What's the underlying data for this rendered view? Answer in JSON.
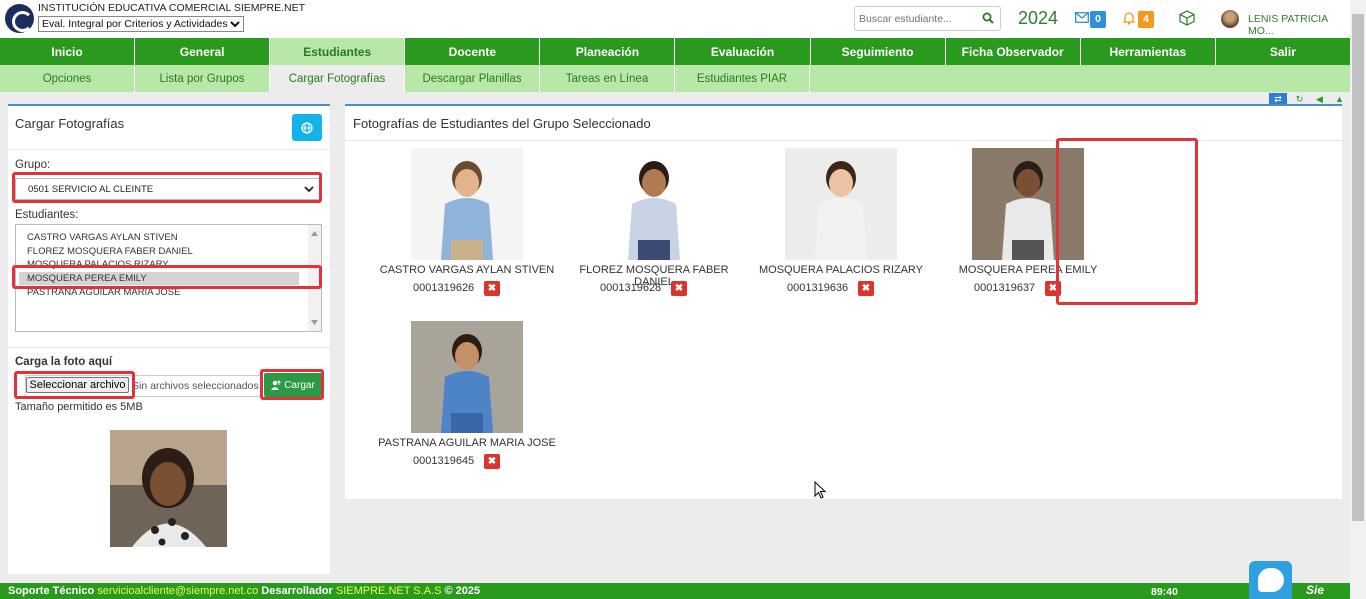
{
  "header": {
    "institution_name": "INSTITUCIÓN EDUCATIVA COMERCIAL SIEMPRE.NET",
    "eval_select_value": "Eval. Integral por Criterios y Actividades",
    "search_placeholder": "Buscar estudiante...",
    "year": "2024",
    "messages_count": "0",
    "notifications_count": "4",
    "user_name": "LENIS PATRICIA MO..."
  },
  "main_nav": [
    {
      "label": "Inicio"
    },
    {
      "label": "General"
    },
    {
      "label": "Estudiantes"
    },
    {
      "label": "Docente"
    },
    {
      "label": "Planeación"
    },
    {
      "label": "Evaluación"
    },
    {
      "label": "Seguimiento"
    },
    {
      "label": "Ficha Observador"
    },
    {
      "label": "Herramientas"
    },
    {
      "label": "Salir"
    }
  ],
  "main_nav_active": "Estudiantes",
  "sub_nav": [
    {
      "label": "Opciones"
    },
    {
      "label": "Lista por Grupos"
    },
    {
      "label": "Cargar Fotografías"
    },
    {
      "label": "Descargar Planillas"
    },
    {
      "label": "Tareas en Línea"
    },
    {
      "label": "Estudiantes PIAR"
    }
  ],
  "sub_nav_active": "Cargar Fotografías",
  "left_panel": {
    "title": "Cargar Fotografías",
    "grupo_label": "Grupo:",
    "grupo_value": "0501 SERVICIO AL CLEINTE",
    "estudiantes_label": "Estudiantes:",
    "students": [
      "CASTRO VARGAS AYLAN STIVEN",
      "FLOREZ MOSQUERA FABER DANIEL",
      "MOSQUERA PALACIOS RIZARY",
      "MOSQUERA PEREA EMILY",
      "PASTRANA AGUILAR MARIA JOSE"
    ],
    "selected_student": "MOSQUERA PEREA EMILY",
    "upload_label": "Carga la foto aquí",
    "file_button_label": "Seleccionar archivo",
    "file_none_text": "Sin archivos seleccionados",
    "upload_button_label": "Cargar",
    "size_note": "Tamaño permitido es 5MB"
  },
  "right_panel": {
    "title": "Fotografías de Estudiantes del Grupo Seleccionado",
    "students": [
      {
        "name": "CASTRO VARGAS AYLAN STIVEN",
        "code": "0001319626"
      },
      {
        "name": "FLOREZ MOSQUERA FABER DANIEL",
        "code": "0001319628"
      },
      {
        "name": "MOSQUERA PALACIOS RIZARY",
        "code": "0001319636"
      },
      {
        "name": "MOSQUERA PEREA EMILY",
        "code": "0001319637"
      },
      {
        "name": "PASTRANA AGUILAR MARIA JOSE",
        "code": "0001319645"
      }
    ],
    "delete_glyph": "✖"
  },
  "footer": {
    "support_label": "Soporte Técnico",
    "support_email": "servicioalcliente@siempre.net.co",
    "dev_label": "Desarrollador",
    "dev_name": "SIEMPRE.NET S.A.S",
    "copyright": "© 2025",
    "timer": "89:40",
    "brand": "Sie"
  },
  "colors": {
    "nav_green": "#2a9a1f",
    "subnav_green": "#b7e8a8",
    "highlight_red": "#e0343a",
    "accent_blue": "#4c8cc8"
  }
}
